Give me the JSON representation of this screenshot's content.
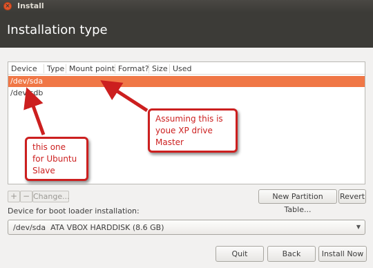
{
  "window": {
    "title": "Install",
    "close_glyph": "×"
  },
  "page": {
    "heading": "Installation type"
  },
  "table": {
    "columns": [
      "Device",
      "Type",
      "Mount point",
      "Format?",
      "Size",
      "Used"
    ],
    "rows": [
      "/dev/sda",
      "/dev/sdb"
    ],
    "selected_row": "/dev/sda",
    "selected_color": "#f07746"
  },
  "toolbar": {
    "add": "+",
    "remove": "−",
    "change": "Change...",
    "new_partition_table": "New Partition Table...",
    "revert": "Revert"
  },
  "bootloader": {
    "label": "Device for boot loader installation:",
    "value": "/dev/sda  ATA VBOX HARDDISK (8.6 GB)"
  },
  "buttons": {
    "quit": "Quit",
    "back": "Back",
    "install_now": "Install Now"
  },
  "annotations": {
    "color": "#cc1f1f",
    "master": "Assuming this is\nyoue XP drive\nMaster",
    "slave": "this one\nfor Ubuntu\nSlave"
  },
  "icons": {
    "close": "close-icon",
    "dropdown": "chevron-down-icon",
    "arrow": "red-arrow"
  }
}
